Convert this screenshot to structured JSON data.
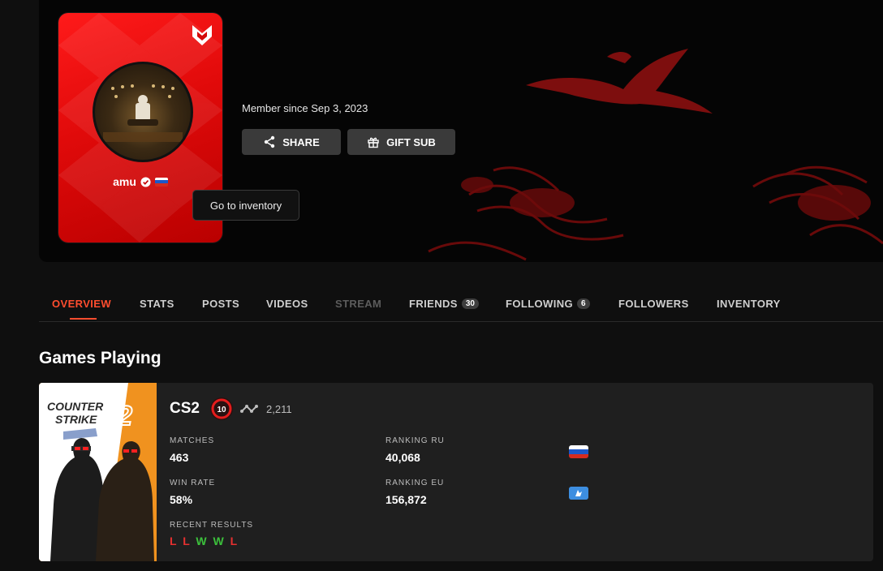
{
  "profile": {
    "username": "amu",
    "member_since": "Member since Sep 3, 2023",
    "country_flag": "RU"
  },
  "actions": {
    "share_label": "SHARE",
    "gift_label": "GIFT SUB",
    "tooltip": "Go to inventory"
  },
  "tabs": [
    {
      "label": "OVERVIEW",
      "active": true
    },
    {
      "label": "STATS"
    },
    {
      "label": "POSTS"
    },
    {
      "label": "VIDEOS"
    },
    {
      "label": "STREAM",
      "disabled": true
    },
    {
      "label": "FRIENDS",
      "count": "30"
    },
    {
      "label": "FOLLOWING",
      "count": "6"
    },
    {
      "label": "FOLLOWERS"
    },
    {
      "label": "INVENTORY"
    }
  ],
  "games": {
    "section_title": "Games Playing",
    "cs2": {
      "cover_text_line1": "COUNTER",
      "cover_text_line2": "STRIKE",
      "cover_text_number": "2",
      "name": "CS2",
      "level": "10",
      "elo": "2,211",
      "matches_label": "MATCHES",
      "matches": "463",
      "winrate_label": "WIN RATE",
      "winrate": "58%",
      "recent_label": "RECENT RESULTS",
      "recent": [
        "L",
        "L",
        "W",
        "W",
        "L"
      ],
      "ranking_ru_label": "RANKING RU",
      "ranking_ru": "40,068",
      "ranking_eu_label": "RANKING EU",
      "ranking_eu": "156,872"
    }
  },
  "colors": {
    "accent": "#ff4d2e",
    "card_red": "#e00a0a",
    "win": "#3cc13c",
    "loss": "#e63030",
    "level_badge": "#e51c1c",
    "cover_orange": "#f0921f"
  }
}
